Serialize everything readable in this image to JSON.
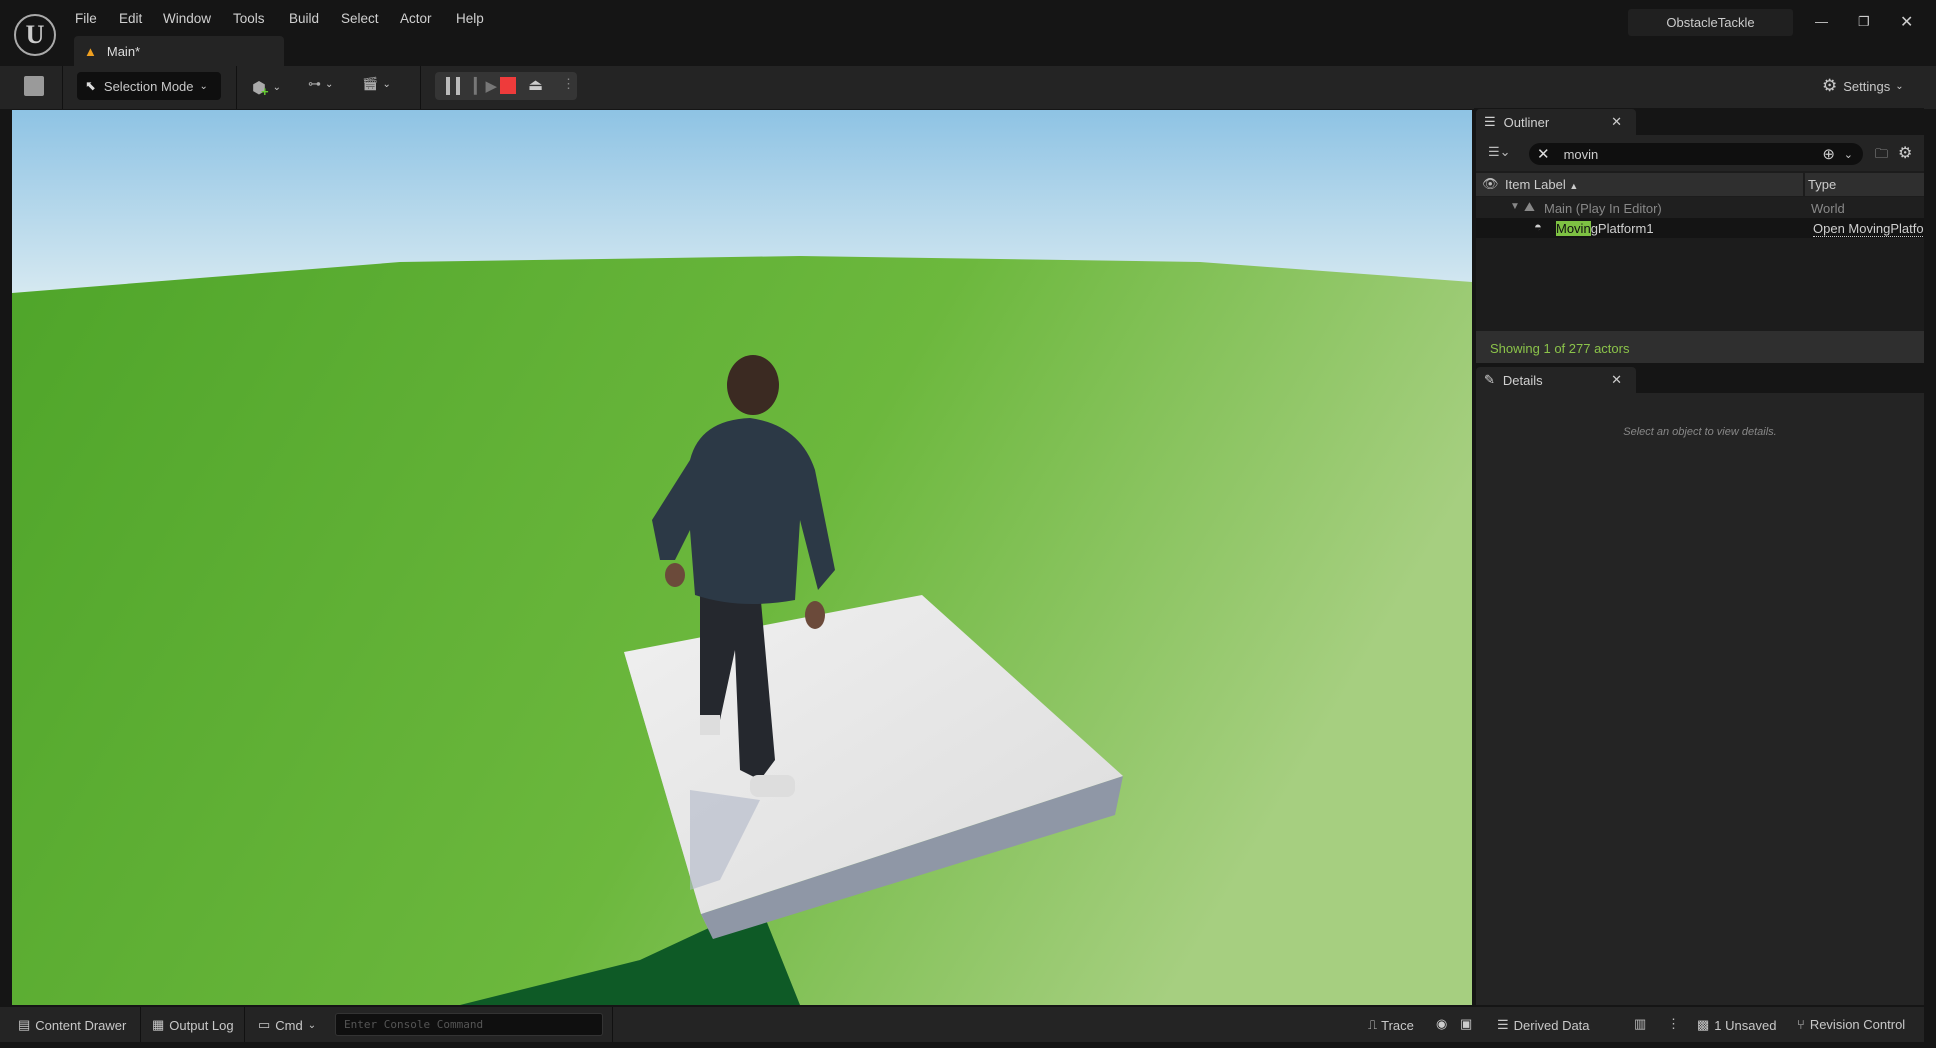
{
  "menu": [
    "File",
    "Edit",
    "Window",
    "Tools",
    "Build",
    "Select",
    "Actor",
    "Help"
  ],
  "tab": {
    "label": "Main*"
  },
  "window_title": "ObstacleTackle",
  "toolbar": {
    "selection_mode": "Selection Mode",
    "settings": "Settings"
  },
  "outliner": {
    "title": "Outliner",
    "search_value": "movin",
    "col_label": "Item Label",
    "col_type": "Type",
    "rows": [
      {
        "label": "Main (Play In Editor)",
        "type": "World"
      },
      {
        "label_highlight": "Movin",
        "label_rest": "gPlatform1",
        "type": "Open MovingPlatform"
      }
    ],
    "status": "Showing 1 of 277 actors"
  },
  "details": {
    "title": "Details",
    "empty": "Select an object to view details."
  },
  "bottom": {
    "content_drawer": "Content Drawer",
    "output_log": "Output Log",
    "cmd": "Cmd",
    "console_placeholder": "Enter Console Command",
    "trace": "Trace",
    "derived_data": "Derived Data",
    "unsaved": "1 Unsaved",
    "revision_control": "Revision Control"
  },
  "colors": {
    "accent_green": "#8bc34a",
    "highlight": "#7ec243",
    "stop": "#ee3b3b"
  }
}
